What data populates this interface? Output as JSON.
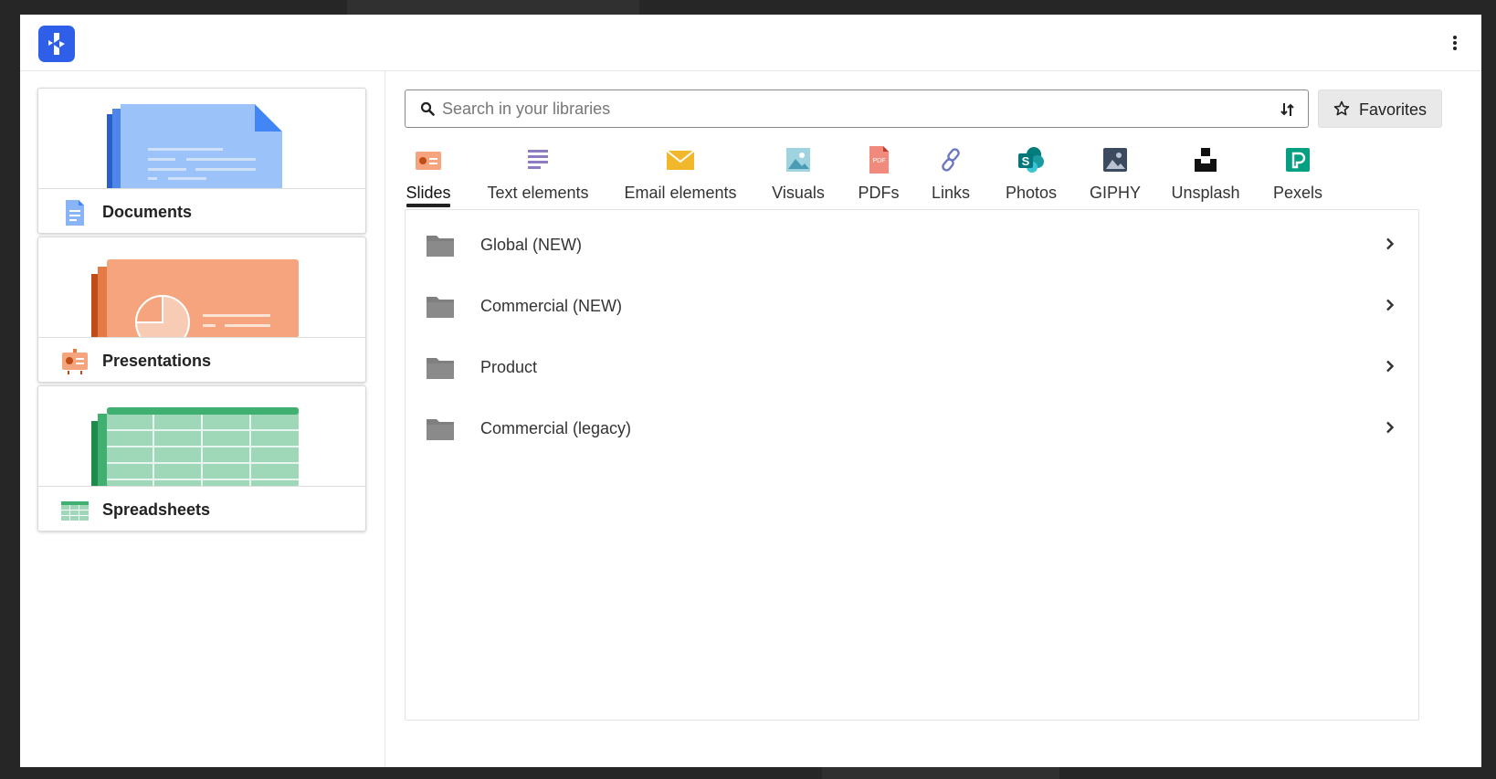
{
  "app": {
    "logo_icon": "app-logo-icon",
    "menu_icon": "more-vertical-icon"
  },
  "sidebar": {
    "cards": [
      {
        "label": "Documents",
        "icon": "document-icon",
        "color": "#8ab4f8"
      },
      {
        "label": "Presentations",
        "icon": "presentation-icon",
        "color": "#f4a582"
      },
      {
        "label": "Spreadsheets",
        "icon": "spreadsheet-icon",
        "color": "#8fd3b0"
      }
    ]
  },
  "search": {
    "placeholder": "Search in your libraries",
    "value": ""
  },
  "favorites": {
    "label": "Favorites",
    "icon": "star-icon"
  },
  "tabs": [
    {
      "label": "Slides",
      "icon": "slides-icon",
      "active": true
    },
    {
      "label": "Text elements",
      "icon": "text-elements-icon",
      "active": false
    },
    {
      "label": "Email elements",
      "icon": "email-icon",
      "active": false
    },
    {
      "label": "Visuals",
      "icon": "image-icon",
      "active": false
    },
    {
      "label": "PDFs",
      "icon": "pdf-icon",
      "active": false
    },
    {
      "label": "Links",
      "icon": "link-icon",
      "active": false
    },
    {
      "label": "Photos",
      "icon": "sharepoint-icon",
      "active": false
    },
    {
      "label": "GIPHY",
      "icon": "giphy-icon",
      "active": false
    },
    {
      "label": "Unsplash",
      "icon": "unsplash-icon",
      "active": false
    },
    {
      "label": "Pexels",
      "icon": "pexels-icon",
      "active": false
    }
  ],
  "folders": [
    {
      "label": "Global (NEW)"
    },
    {
      "label": "Commercial (NEW)"
    },
    {
      "label": "Product"
    },
    {
      "label": "Commercial (legacy)"
    }
  ],
  "colors": {
    "accent": "#2f5fe8",
    "folder": "#7f7f7f"
  }
}
